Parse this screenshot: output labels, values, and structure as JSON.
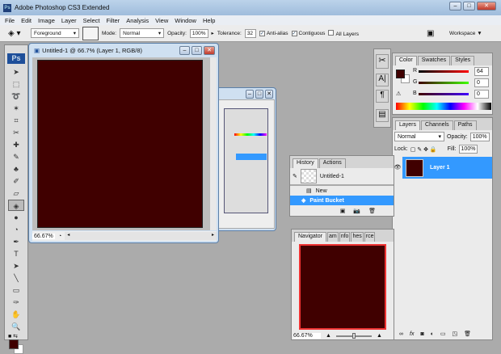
{
  "app": {
    "title": "Adobe Photoshop CS3 Extended",
    "icon": "ps-icon"
  },
  "menu": [
    "File",
    "Edit",
    "Image",
    "Layer",
    "Select",
    "Filter",
    "Analysis",
    "View",
    "Window",
    "Help"
  ],
  "options": {
    "fill_source": "Foreground",
    "mode_label": "Mode:",
    "mode": "Normal",
    "opacity_label": "Opacity:",
    "opacity": "100%",
    "tolerance_label": "Tolerance:",
    "tolerance": "32",
    "anti_alias": "Anti-alias",
    "contiguous": "Contiguous",
    "all_layers": "All Layers",
    "workspace": "Workspace ▼"
  },
  "toolbox": {
    "logo": "Ps",
    "tools": [
      "move-icon",
      "marquee-icon",
      "lasso-icon",
      "magic-wand-icon",
      "crop-icon",
      "slice-icon",
      "healing-icon",
      "brush-icon",
      "clone-stamp-icon",
      "history-brush-icon",
      "eraser-icon",
      "paint-bucket-icon",
      "blur-icon",
      "dodge-icon",
      "pen-icon",
      "type-icon",
      "path-select-icon",
      "line-icon",
      "notes-icon",
      "eyedropper-icon",
      "hand-icon",
      "zoom-icon"
    ],
    "type_glyph": "T"
  },
  "document": {
    "title": "Untitled-1 @ 66.7% (Layer 1, RGB/8)",
    "zoom": "66.67%",
    "canvas_color": "#400000"
  },
  "colors": {
    "foreground": "#400000",
    "background": "#ffffff"
  },
  "color_panel": {
    "tabs": [
      "Color",
      "Swatches",
      "Styles"
    ],
    "r_label": "R",
    "g_label": "G",
    "b_label": "B",
    "r": "64",
    "g": "0",
    "b": "0"
  },
  "layers_panel": {
    "tabs": [
      "Layers",
      "Channels",
      "Paths"
    ],
    "blend": "Normal",
    "opacity_label": "Opacity:",
    "opacity": "100%",
    "lock_label": "Lock:",
    "fill_label": "Fill:",
    "fill": "100%",
    "layers": [
      {
        "name": "Layer 1"
      }
    ]
  },
  "history_panel": {
    "tabs": [
      "History",
      "Actions"
    ],
    "snapshot": "Untitled-1",
    "items": [
      "New",
      "Paint Bucket"
    ]
  },
  "navigator_panel": {
    "tabs": [
      "Navigator",
      "am",
      "nfo",
      "hes",
      "rce"
    ],
    "zoom": "66.67%"
  }
}
